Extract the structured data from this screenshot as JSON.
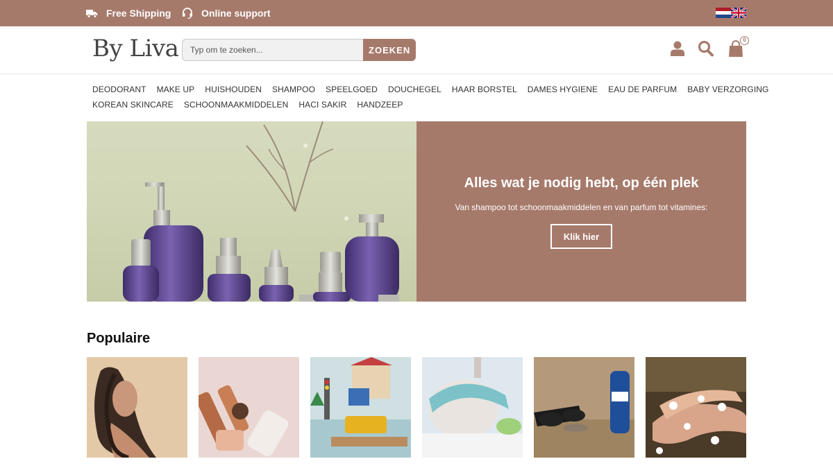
{
  "topbar": {
    "shipping": "Free Shipping",
    "support": "Online support",
    "shipping_icon": "truck-icon",
    "support_icon": "headset-icon",
    "flags": [
      "nl-flag-icon",
      "uk-flag-icon"
    ]
  },
  "header": {
    "logo": "By Liva",
    "search_placeholder": "Typ om te zoeken...",
    "search_button": "ZOEKEN",
    "cart_count": "0",
    "icons": [
      "user-icon",
      "search-icon",
      "shopping-bag-icon"
    ]
  },
  "nav": {
    "row1": [
      "DEODORANT",
      "MAKE UP",
      "HUISHOUDEN",
      "SHAMPOO",
      "SPEELGOED",
      "DOUCHEGEL",
      "HAAR BORSTEL",
      "DAMES HYGIENE",
      "EAU DE PARFUM",
      "BABY VERZORGING"
    ],
    "row2": [
      "KOREAN SKINCARE",
      "SCHOONMAAKMIDDELEN",
      "HACI SAKIR",
      "HANDZEEP"
    ]
  },
  "hero": {
    "title": "Alles wat je nodig hebt, op één plek",
    "subtitle": "Van shampoo tot schoonmaakmiddelen en van parfum tot vitamines:",
    "button": "Klik hier"
  },
  "popular": {
    "title": "Populaire"
  },
  "colors": {
    "brand": "#a67a6b",
    "background": "#ffffff"
  }
}
